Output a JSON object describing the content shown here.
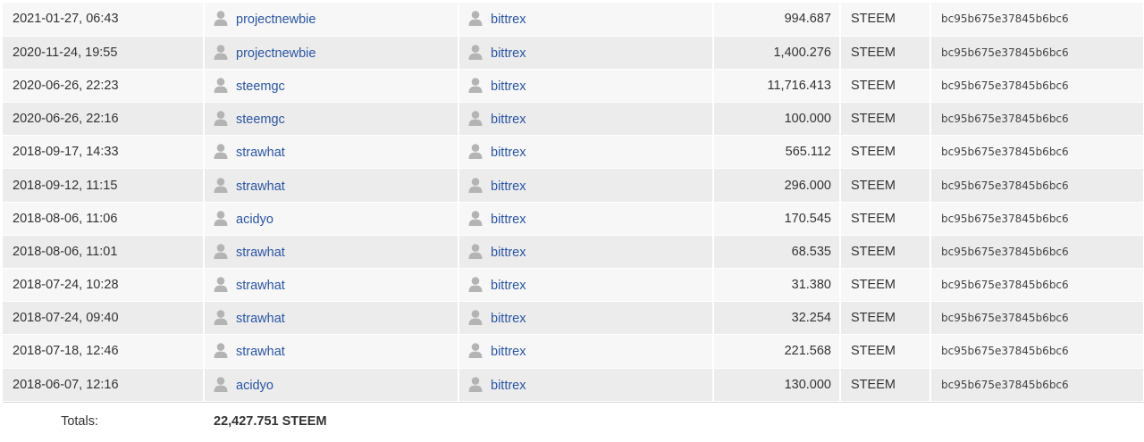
{
  "table": {
    "rows": [
      {
        "date": "2021-01-27, 06:43",
        "from": "projectnewbie",
        "to": "bittrex",
        "amount": "994.687",
        "asset": "STEEM",
        "memo": "bc95b675e37845b6bc6"
      },
      {
        "date": "2020-11-24, 19:55",
        "from": "projectnewbie",
        "to": "bittrex",
        "amount": "1,400.276",
        "asset": "STEEM",
        "memo": "bc95b675e37845b6bc6"
      },
      {
        "date": "2020-06-26, 22:23",
        "from": "steemgc",
        "to": "bittrex",
        "amount": "11,716.413",
        "asset": "STEEM",
        "memo": "bc95b675e37845b6bc6"
      },
      {
        "date": "2020-06-26, 22:16",
        "from": "steemgc",
        "to": "bittrex",
        "amount": "100.000",
        "asset": "STEEM",
        "memo": "bc95b675e37845b6bc6"
      },
      {
        "date": "2018-09-17, 14:33",
        "from": "strawhat",
        "to": "bittrex",
        "amount": "565.112",
        "asset": "STEEM",
        "memo": "bc95b675e37845b6bc6"
      },
      {
        "date": "2018-09-12, 11:15",
        "from": "strawhat",
        "to": "bittrex",
        "amount": "296.000",
        "asset": "STEEM",
        "memo": "bc95b675e37845b6bc6"
      },
      {
        "date": "2018-08-06, 11:06",
        "from": "acidyo",
        "to": "bittrex",
        "amount": "170.545",
        "asset": "STEEM",
        "memo": "bc95b675e37845b6bc6"
      },
      {
        "date": "2018-08-06, 11:01",
        "from": "strawhat",
        "to": "bittrex",
        "amount": "68.535",
        "asset": "STEEM",
        "memo": "bc95b675e37845b6bc6"
      },
      {
        "date": "2018-07-24, 10:28",
        "from": "strawhat",
        "to": "bittrex",
        "amount": "31.380",
        "asset": "STEEM",
        "memo": "bc95b675e37845b6bc6"
      },
      {
        "date": "2018-07-24, 09:40",
        "from": "strawhat",
        "to": "bittrex",
        "amount": "32.254",
        "asset": "STEEM",
        "memo": "bc95b675e37845b6bc6"
      },
      {
        "date": "2018-07-18, 12:46",
        "from": "strawhat",
        "to": "bittrex",
        "amount": "221.568",
        "asset": "STEEM",
        "memo": "bc95b675e37845b6bc6"
      },
      {
        "date": "2018-06-07, 12:16",
        "from": "acidyo",
        "to": "bittrex",
        "amount": "130.000",
        "asset": "STEEM",
        "memo": "bc95b675e37845b6bc6"
      }
    ],
    "totals_label": "Totals:",
    "totals_value": "22,427.751 STEEM"
  },
  "icons": {
    "account": "user-icon"
  },
  "colors": {
    "link": "#2a55a5",
    "row_odd": "#f7f7f7",
    "row_even": "#ececec",
    "icon": "#b4b4b4"
  }
}
